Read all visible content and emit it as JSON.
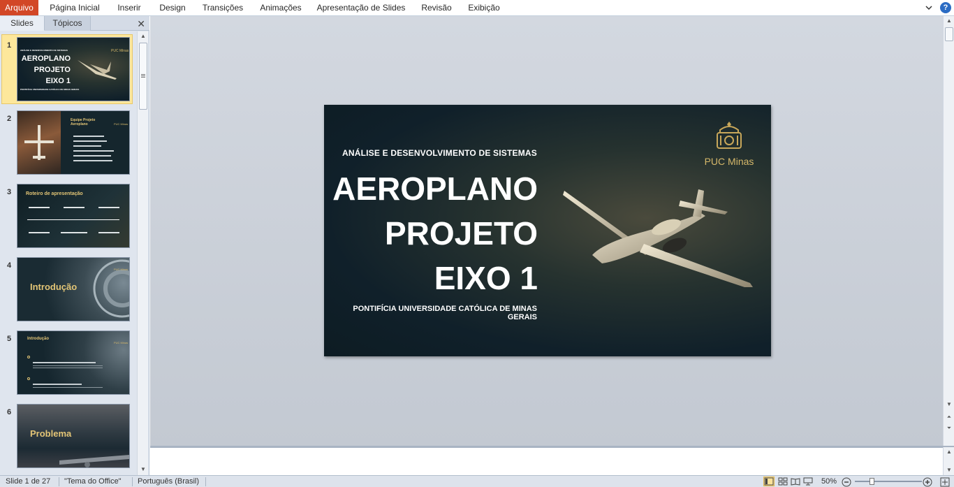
{
  "ribbon": {
    "tabs": [
      "Arquivo",
      "Página Inicial",
      "Inserir",
      "Design",
      "Transições",
      "Animações",
      "Apresentação de Slides",
      "Revisão",
      "Exibição"
    ],
    "help_label": "?"
  },
  "panel": {
    "tabs": [
      "Slides",
      "Tópicos"
    ],
    "close_label": "✕"
  },
  "thumbnails": [
    {
      "num": "1",
      "kicker": "ANÁLISE E DESENVOLVIMENTO DE SISTEMAS",
      "title": [
        "AEROPLANO",
        "PROJETO",
        "EIXO 1"
      ],
      "footer": "PONTIFÍCIA UNIVERSIDADE CATÓLICA DE MINAS GERAIS",
      "logo": "PUC Minas"
    },
    {
      "num": "2",
      "title": "Equipe Projeto Aeroplano",
      "logo": "PUC Minas"
    },
    {
      "num": "3",
      "title": "Roteiro de apresentação"
    },
    {
      "num": "4",
      "title": "Introdução",
      "logo": "PUC Minas"
    },
    {
      "num": "5",
      "title": "Introdução",
      "logo": "PUC Minas"
    },
    {
      "num": "6",
      "title": "Problema"
    }
  ],
  "slide": {
    "kicker": "ANÁLISE E DESENVOLVIMENTO DE SISTEMAS",
    "title_lines": [
      "AEROPLANO",
      "PROJETO",
      "EIXO 1"
    ],
    "subtitle": "PONTIFÍCIA UNIVERSIDADE CATÓLICA DE MINAS GERAIS",
    "logo_text": "PUC Minas"
  },
  "status": {
    "slide_info": "Slide 1 de 27",
    "theme": "\"Tema do Office\"",
    "language": "Português (Brasil)",
    "zoom": "50%",
    "zoom_fraction": 0.25
  },
  "colors": {
    "file_tab": "#d24726",
    "selection": "#fde79b",
    "logo_gold": "#d6b86a"
  }
}
